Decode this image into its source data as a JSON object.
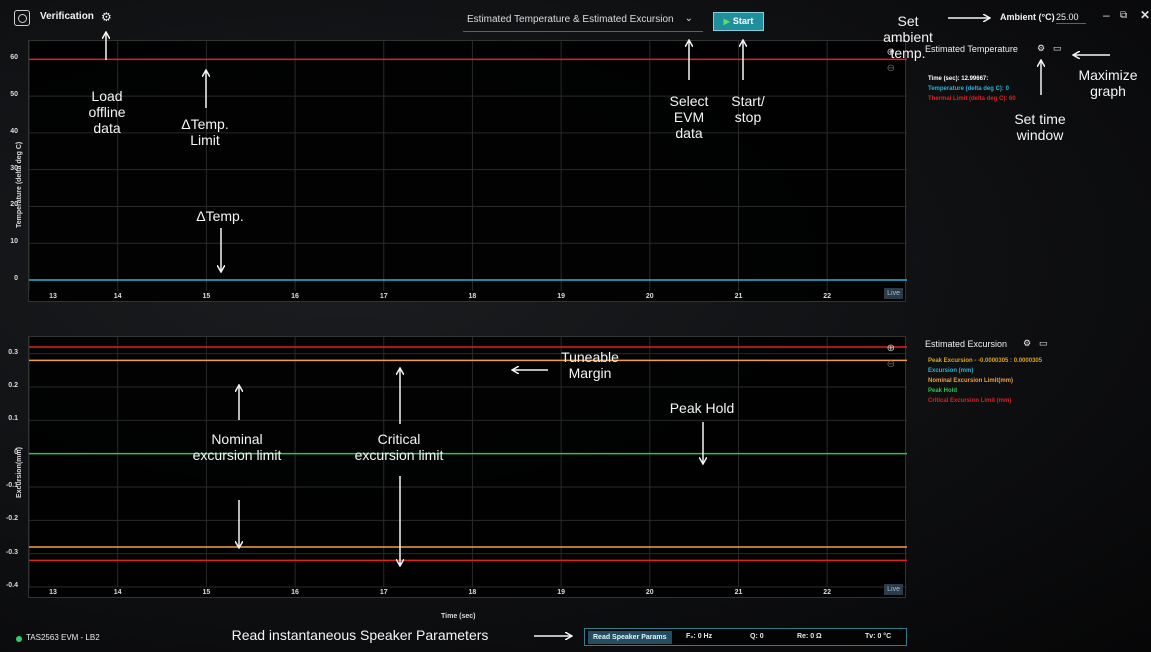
{
  "app": {
    "title": "Verification",
    "logo_icon": "app-logo-icon",
    "data_select_value": "Estimated Temperature & Estimated Excursion",
    "start_label": "Start",
    "ambient_label": "Ambient (°C)",
    "ambient_value": "25.00",
    "window_controls": {
      "minimize": "–",
      "restore": "⧉",
      "close": "✕"
    }
  },
  "temperature_plot": {
    "title": "Estimated Temperature",
    "y_axis_label": "Temperature (delta deg C)",
    "live_label": "Live",
    "legend": [
      {
        "label": "Time (sec): 12.99667:",
        "color": "#ffffff"
      },
      {
        "label": "Temperature (delta deg C): 0",
        "color": "#2bb3d6"
      },
      {
        "label": "Thermal Limit (delta deg C): 60",
        "color": "#e02020"
      }
    ]
  },
  "excursion_plot": {
    "title": "Estimated Excursion",
    "y_axis_label": "Excursion(mm)",
    "x_axis_label": "Time (sec)",
    "live_label": "Live",
    "legend": [
      {
        "label": "Peak Excursion - -0.0000305 : 0.0000305",
        "color": "#d9a520"
      },
      {
        "label": "Excursion (mm)",
        "color": "#2bb3d6"
      },
      {
        "label": "Nominal Excursion Limit(mm)",
        "color": "#f0a040"
      },
      {
        "label": "Peak Hold",
        "color": "#2fbf4f"
      },
      {
        "label": "Critical Excursion Limit (mm)",
        "color": "#e02020"
      }
    ]
  },
  "chart_data": [
    {
      "type": "line",
      "y_label": "Temperature (delta deg C)",
      "xlim": [
        13,
        22.9
      ],
      "ylim": [
        -3,
        65
      ],
      "x_ticks": [
        13,
        14,
        15,
        16,
        17,
        18,
        19,
        20,
        21,
        22
      ],
      "y_ticks": [
        0,
        10,
        20,
        30,
        40,
        50,
        60
      ],
      "grid": true,
      "series": [
        {
          "name": "Temperature (delta deg C)",
          "color": "#2bb3d6",
          "constant": 0
        },
        {
          "name": "Thermal Limit (delta deg C)",
          "color": "#e02020",
          "constant": 60
        }
      ]
    },
    {
      "type": "line",
      "x_label": "Time (sec)",
      "y_label": "Excursion(mm)",
      "xlim": [
        13,
        22.9
      ],
      "ylim": [
        -0.4,
        0.35
      ],
      "x_ticks": [
        13,
        14,
        15,
        16,
        17,
        18,
        19,
        20,
        21,
        22
      ],
      "y_ticks": [
        -0.4,
        -0.3,
        -0.2,
        -0.1,
        0,
        0.1,
        0.2,
        0.3
      ],
      "y_tick_labels": [
        "-0.4",
        "-0.3",
        "-0.2",
        "-0.1",
        "0",
        "0.1",
        "0.2",
        "0.3"
      ],
      "grid": true,
      "series": [
        {
          "name": "Critical Excursion Limit (mm)",
          "color": "#e02020",
          "constant": 0.32
        },
        {
          "name": "Nominal Excursion Limit(mm)",
          "color": "#f0a040",
          "constant": 0.28
        },
        {
          "name": "Peak Hold",
          "color": "#2fbf4f",
          "constant": 0
        },
        {
          "name": "Nominal Excursion Limit(mm)",
          "color": "#f0a040",
          "constant": -0.28
        },
        {
          "name": "Critical Excursion Limit (mm)",
          "color": "#e02020",
          "constant": -0.32
        }
      ]
    }
  ],
  "status": {
    "device_label": "TAS2563 EVM - LB2",
    "read_params_label": "Read Speaker Params",
    "f0": "F₀: 0 Hz",
    "q": "Q: 0",
    "re": "Re: 0 Ω",
    "tv": "Tv: 0 °C"
  },
  "annotations": {
    "load_offline": "Load\noffline\ndata",
    "temp_limit": "ΔTemp.\nLimit",
    "temp": "ΔTemp.",
    "select_evm": "Select\nEVM\ndata",
    "start_stop": "Start/\nstop",
    "set_ambient": "Set\nambient\ntemp.",
    "maximize": "Maximize\ngraph",
    "set_time_window": "Set time\nwindow",
    "tuneable_margin": "Tuneable\nMargin",
    "nominal_limit": "Nominal\nexcursion limit",
    "critical_limit": "Critical\nexcursion limit",
    "peak_hold": "Peak Hold",
    "read_params": "Read instantaneous Speaker Parameters"
  }
}
